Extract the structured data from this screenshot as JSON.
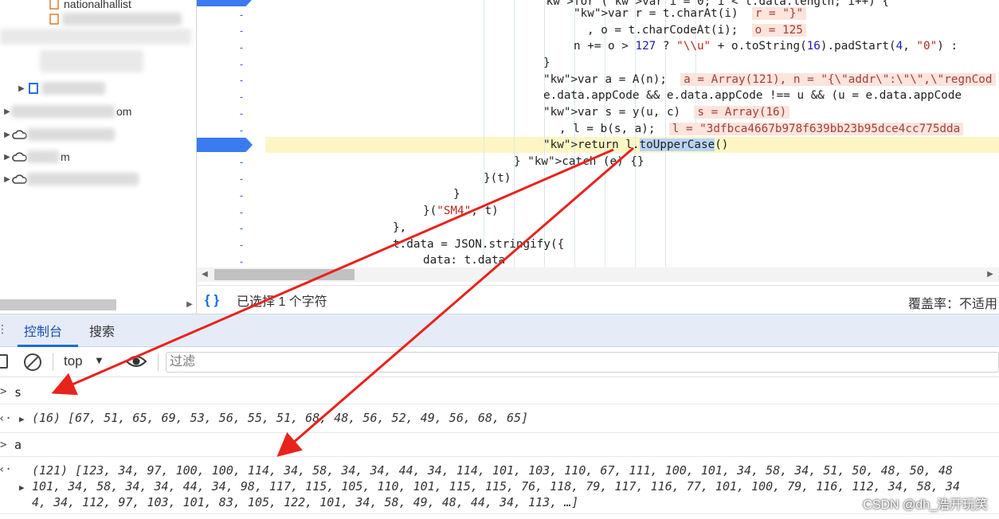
{
  "tree": {
    "items": [
      {
        "label": "nationalhallist",
        "kind": "file"
      },
      {
        "label": "",
        "kind": "file"
      },
      {
        "label": "",
        "kind": "file"
      },
      {
        "label": "",
        "kind": "file"
      },
      {
        "label": "",
        "kind": "folder"
      },
      {
        "label": "om",
        "kind": "domain"
      },
      {
        "label": "",
        "kind": "cloud"
      },
      {
        "label": "m",
        "kind": "cloud"
      },
      {
        "label": "",
        "kind": "cloud"
      }
    ]
  },
  "editor": {
    "lines": [
      {
        "code": "for (var i = 0; i < t.data.length; i++) {"
      },
      {
        "code": "var r = t.charAt(i)",
        "value": "r = \"}\""
      },
      {
        "code": ", o = t.charCodeAt(i);",
        "value": "o = 125"
      },
      {
        "code": "n += o > 127 ? \"\\\\u\" + o.toString(16).padStart(4, \"0\") :"
      },
      {
        "code": "}"
      },
      {
        "code": "var a = A(n);",
        "value": "a = Array(121), n = \"{\\\"addr\\\":\\\"\\\",\\\"regnCod"
      },
      {
        "code": "e.data.appCode && e.data.appCode !== u && (u = e.data.appCode"
      },
      {
        "code": "var s = y(u, c)",
        "value": "s = Array(16)"
      },
      {
        "code": ", l = b(s, a);",
        "value": "l = \"3dfbca4667b978f639bb23b95dce4cc775dda"
      },
      {
        "code_before": "return l.",
        "selected": "toUpperCase",
        "code_after": "()"
      },
      {
        "code": "} catch (e) {}"
      },
      {
        "code": "}(t)"
      },
      {
        "code": "}"
      },
      {
        "code_before": "}(",
        "string": "\"SM4\"",
        "code_after": ", t)"
      },
      {
        "code": "},"
      },
      {
        "code": "t.data = JSON.stringify({"
      },
      {
        "code": "data: t.data"
      }
    ]
  },
  "status": {
    "format_icon": "{ }",
    "selection": "已选择 1 个字符",
    "coverage": "覆盖率：不适用"
  },
  "console": {
    "tabs": [
      {
        "label": "控制台"
      },
      {
        "label": "搜索"
      }
    ],
    "context": "top",
    "filter_placeholder": "过滤",
    "entries": [
      {
        "input": "s",
        "result_lines": [
          "(16) [67, 51, 65, 69, 53, 56, 55, 51, 68, 48, 56, 52, 49, 56, 68, 65]"
        ]
      },
      {
        "input": "a",
        "result_lines": [
          "(121) [123, 34, 97, 100, 100, 114, 34, 58, 34, 34, 44, 34, 114, 101, 103, 110, 67, 111, 100, 101, 34, 58, 34, 51, 50, 48, 50, 48",
          "101, 34, 58, 34, 34, 44, 34, 98, 117, 115, 105, 110, 101, 115, 115, 76, 118, 79, 117, 116, 77, 101, 100, 79, 116, 112, 34, 58, 34",
          "4, 34, 112, 97, 103, 101, 83, 105, 122, 101, 34, 58, 49, 48, 44, 34, 113, …]"
        ]
      }
    ]
  },
  "watermark": "CSDN @dh_浩开玩笑",
  "colors": {
    "accent": "#1a6ae6",
    "breakpoint": "#3a7bf0",
    "arrow": "#e8231b",
    "highlight": "#fdf6c4"
  }
}
